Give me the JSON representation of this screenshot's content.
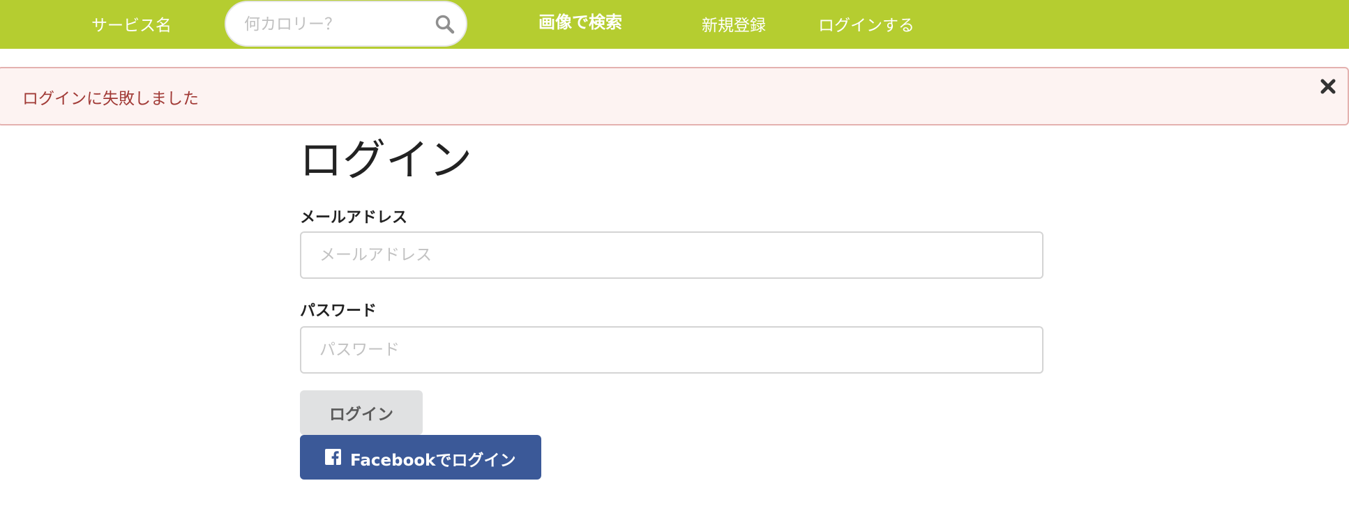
{
  "navbar": {
    "brand": "サービス名",
    "search": {
      "placeholder": "何カロリー？",
      "value": ""
    },
    "links": {
      "search_by_image": "画像で検索",
      "signup": "新規登録",
      "login": "ログインする"
    },
    "background_color": "#b5cd30"
  },
  "alert": {
    "message": "ログインに失敗しました",
    "close_icon": "close-icon"
  },
  "form": {
    "title": "ログイン",
    "email": {
      "label": "メールアドレス",
      "placeholder": "メールアドレス",
      "value": ""
    },
    "password": {
      "label": "パスワード",
      "placeholder": "パスワード",
      "value": ""
    },
    "submit_label": "ログイン",
    "facebook": {
      "label": "Facebookでログイン",
      "icon": "facebook-icon",
      "color": "#3b5998"
    }
  }
}
